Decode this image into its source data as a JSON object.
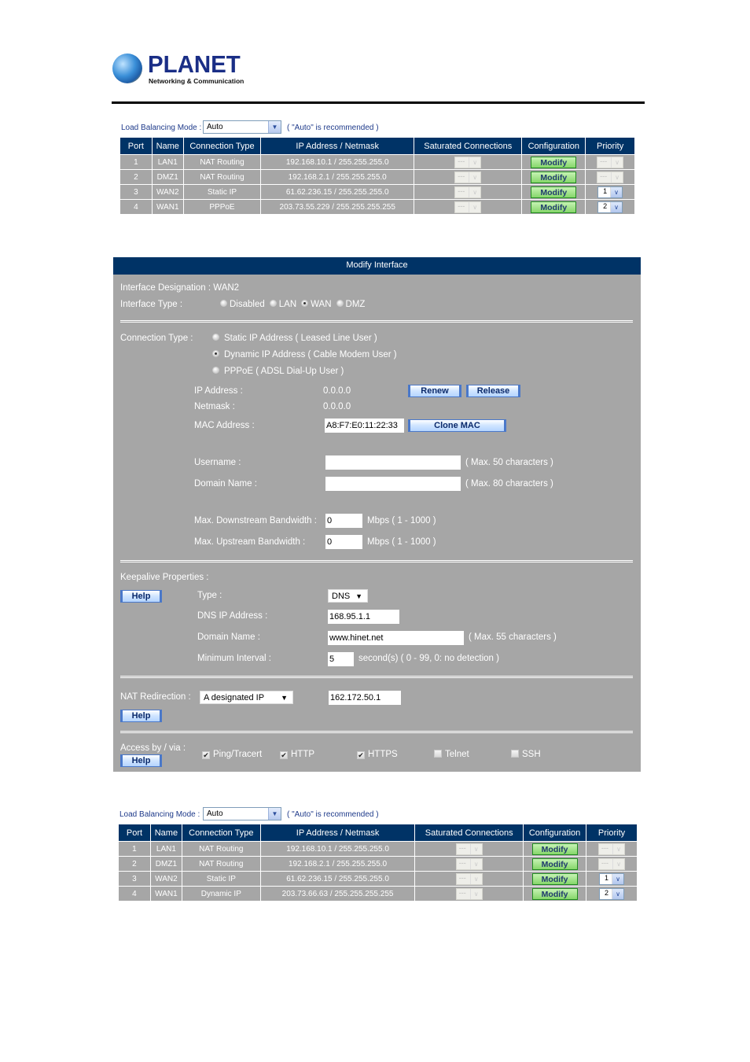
{
  "logo": {
    "brand": "PLANET",
    "tagline": "Networking & Communication"
  },
  "colors": {
    "header_navy": "#003366",
    "panel_gray": "#a6a6a6",
    "modify_green": "#86d66a",
    "link_blue": "#1e3a8a"
  },
  "top_table": {
    "mode_label": "Load Balancing Mode :",
    "mode_value": "Auto",
    "mode_note": "( \"Auto\" is recommended )",
    "headers": [
      "Port",
      "Name",
      "Connection Type",
      "IP Address / Netmask",
      "Saturated Connections",
      "Configuration",
      "Priority"
    ],
    "rows": [
      {
        "port": "1",
        "name": "LAN1",
        "type": "NAT Routing",
        "ip": "192.168.10.1 / 255.255.255.0",
        "saturated": "---",
        "config": "Modify",
        "priority": "---",
        "priority_enabled": false
      },
      {
        "port": "2",
        "name": "DMZ1",
        "type": "NAT Routing",
        "ip": "192.168.2.1 / 255.255.255.0",
        "saturated": "---",
        "config": "Modify",
        "priority": "---",
        "priority_enabled": false
      },
      {
        "port": "3",
        "name": "WAN2",
        "type": "Static IP",
        "ip": "61.62.236.15 / 255.255.255.0",
        "saturated": "---",
        "config": "Modify",
        "priority": "1",
        "priority_enabled": true
      },
      {
        "port": "4",
        "name": "WAN1",
        "type": "PPPoE",
        "ip": "203.73.55.229 / 255.255.255.255",
        "saturated": "---",
        "config": "Modify",
        "priority": "2",
        "priority_enabled": true
      }
    ]
  },
  "modify": {
    "title": "Modify Interface",
    "designation_label": "Interface Designation : WAN2",
    "type_label": "Interface Type :",
    "type_options": [
      "Disabled",
      "LAN",
      "WAN",
      "DMZ"
    ],
    "type_selected": "WAN",
    "conn_label": "Connection Type :",
    "conn_options": [
      "Static IP Address ( Leased Line User )",
      "Dynamic IP Address ( Cable Modem User )",
      "PPPoE ( ADSL Dial-Up User )"
    ],
    "conn_selected": "Dynamic IP Address ( Cable Modem User )",
    "ip_label": "IP Address :",
    "ip_value": "0.0.0.0",
    "renew": "Renew",
    "release": "Release",
    "netmask_label": "Netmask :",
    "netmask_value": "0.0.0.0",
    "mac_label": "MAC Address :",
    "mac_value": "A8:F7:E0:11:22:33",
    "clone_mac": "Clone MAC",
    "username_label": "Username :",
    "username_value": "",
    "username_note": "( Max. 50 characters )",
    "domain_label": "Domain Name :",
    "domain_value": "",
    "domain_note": "( Max. 80 characters )",
    "down_label": "Max. Downstream Bandwidth :",
    "down_value": "0",
    "down_unit": "Mbps ( 1 - 1000 )",
    "up_label": "Max. Upstream Bandwidth :",
    "up_value": "0",
    "up_unit": "Mbps ( 1 - 1000 )",
    "keepalive_label": "Keepalive Properties :",
    "help": "Help",
    "ka_type_label": "Type :",
    "ka_type_value": "DNS",
    "ka_dns_label": "DNS IP Address :",
    "ka_dns_value": "168.95.1.1",
    "ka_domain_label": "Domain Name :",
    "ka_domain_value": "www.hinet.net",
    "ka_domain_note": "( Max. 55 characters )",
    "ka_interval_label": "Minimum Interval :",
    "ka_interval_value": "5",
    "ka_interval_note": "second(s)  ( 0 - 99, 0: no detection )",
    "nat_label": "NAT Redirection :",
    "nat_value": "A designated IP",
    "nat_ip": "162.172.50.1",
    "access_label": "Access by / via :",
    "access": [
      {
        "label": "Ping/Tracert",
        "checked": true
      },
      {
        "label": "HTTP",
        "checked": true
      },
      {
        "label": "HTTPS",
        "checked": true
      },
      {
        "label": "Telnet",
        "checked": false
      },
      {
        "label": "SSH",
        "checked": false
      }
    ]
  },
  "bottom_table": {
    "mode_label": "Load Balancing Mode :",
    "mode_value": "Auto",
    "mode_note": "( \"Auto\" is recommended )",
    "headers": [
      "Port",
      "Name",
      "Connection Type",
      "IP Address / Netmask",
      "Saturated Connections",
      "Configuration",
      "Priority"
    ],
    "rows": [
      {
        "port": "1",
        "name": "LAN1",
        "type": "NAT Routing",
        "ip": "192.168.10.1 / 255.255.255.0",
        "saturated": "---",
        "config": "Modify",
        "priority": "---",
        "priority_enabled": false
      },
      {
        "port": "2",
        "name": "DMZ1",
        "type": "NAT Routing",
        "ip": "192.168.2.1 / 255.255.255.0",
        "saturated": "---",
        "config": "Modify",
        "priority": "---",
        "priority_enabled": false
      },
      {
        "port": "3",
        "name": "WAN2",
        "type": "Static IP",
        "ip": "61.62.236.15 / 255.255.255.0",
        "saturated": "---",
        "config": "Modify",
        "priority": "1",
        "priority_enabled": true
      },
      {
        "port": "4",
        "name": "WAN1",
        "type": "Dynamic IP",
        "ip": "203.73.66.63 / 255.255.255.255",
        "saturated": "---",
        "config": "Modify",
        "priority": "2",
        "priority_enabled": true
      }
    ]
  }
}
